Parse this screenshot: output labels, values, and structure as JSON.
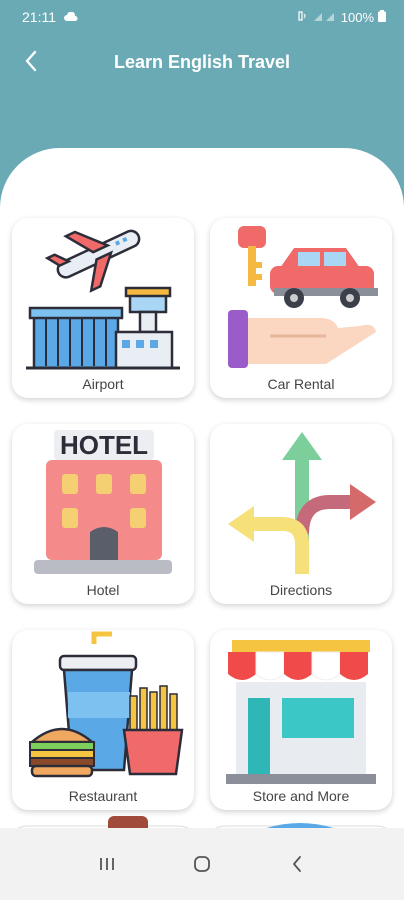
{
  "status_bar": {
    "time": "21:11",
    "battery": "100%"
  },
  "header": {
    "title": "Learn English Travel"
  },
  "categories": [
    {
      "label": "Airport",
      "icon": "airport-icon"
    },
    {
      "label": "Car Rental",
      "icon": "car-rental-icon"
    },
    {
      "label": "Hotel",
      "icon": "hotel-icon"
    },
    {
      "label": "Directions",
      "icon": "directions-icon"
    },
    {
      "label": "Restaurant",
      "icon": "restaurant-icon"
    },
    {
      "label": "Store and More",
      "icon": "store-icon"
    }
  ],
  "hotel_sign": "HOTEL",
  "colors": {
    "header_bg": "#6aaab5",
    "content_bg": "#ffffff",
    "nav_bg": "#f2f2f2"
  }
}
